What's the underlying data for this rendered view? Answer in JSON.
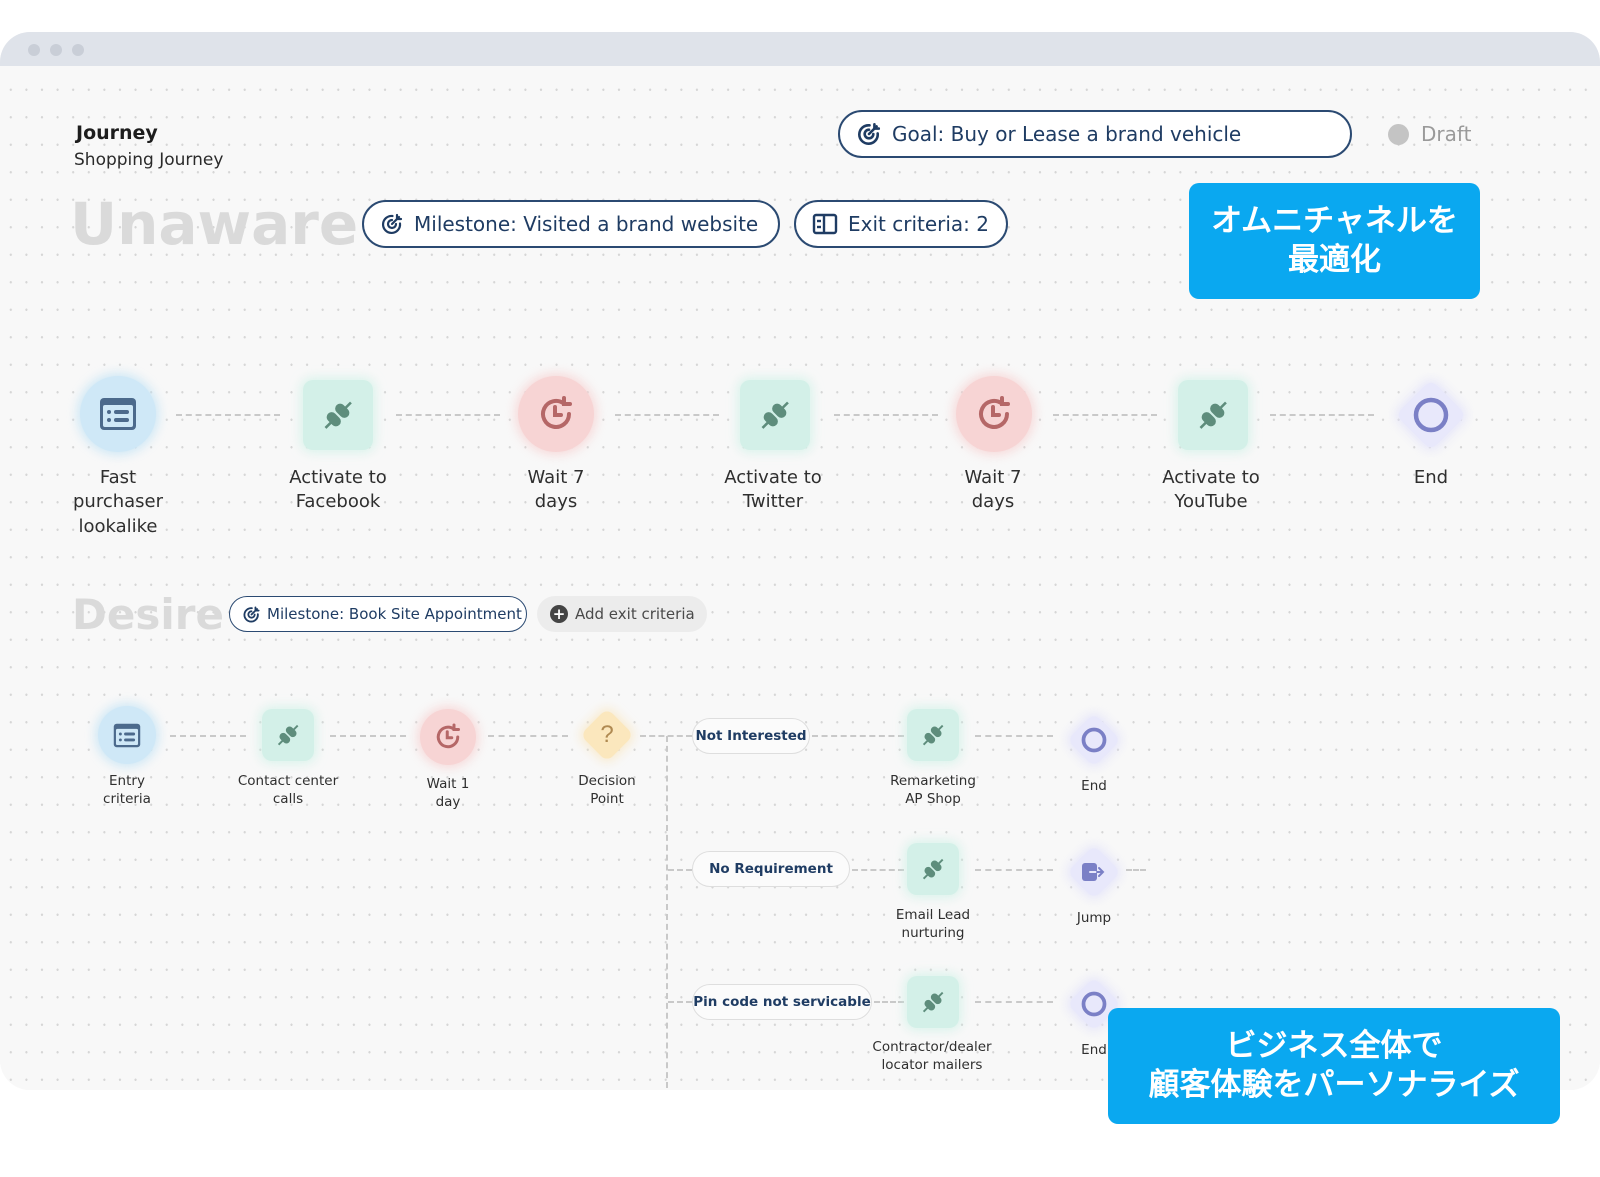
{
  "window": {
    "controls": [
      "close",
      "minimize",
      "maximize"
    ]
  },
  "header": {
    "label": "Journey",
    "journey_name": "Shopping Journey",
    "goal": "Goal: Buy or Lease a brand vehicle",
    "status": "Draft"
  },
  "stages": {
    "unaware": {
      "title": "Unaware",
      "milestone": "Milestone: Visited a brand website",
      "exit_criteria": "Exit criteria: 2",
      "nodes": [
        {
          "type": "audience",
          "icon": "list-icon",
          "label": "Fast\npurchaser\nlookalike"
        },
        {
          "type": "activate",
          "icon": "plug-icon",
          "label": "Activate to\nFacebook"
        },
        {
          "type": "wait",
          "icon": "clock-icon",
          "label": "Wait 7\ndays"
        },
        {
          "type": "activate",
          "icon": "plug-icon",
          "label": "Activate to\nTwitter"
        },
        {
          "type": "wait",
          "icon": "clock-icon",
          "label": "Wait 7\ndays"
        },
        {
          "type": "activate",
          "icon": "plug-icon",
          "label": "Activate to\nYouTube"
        },
        {
          "type": "end",
          "icon": "circle-icon",
          "label": "End"
        }
      ]
    },
    "desire": {
      "title": "Desire",
      "milestone": "Milestone: Book Site Appointment",
      "add_exit": "Add exit criteria",
      "nodes": [
        {
          "type": "audience",
          "icon": "list-icon",
          "label": "Entry\ncriteria"
        },
        {
          "type": "activate",
          "icon": "plug-icon",
          "label": "Contact center\ncalls"
        },
        {
          "type": "wait",
          "icon": "clock-icon",
          "label": "Wait 1\nday"
        },
        {
          "type": "decision",
          "icon": "question-icon",
          "label": "Decision\nPoint",
          "glyph": "?"
        }
      ],
      "branches": [
        {
          "condition": "Not Interested",
          "action": "Remarketing\nAP Shop",
          "terminal": "End",
          "terminal_type": "end"
        },
        {
          "condition": "No Requirement",
          "action": "Email Lead\nnurturing",
          "terminal": "Jump",
          "terminal_type": "jump"
        },
        {
          "condition": "Pin code not servicable",
          "action": "Contractor/dealer\nlocator mailers",
          "terminal": "End",
          "terminal_type": "end"
        }
      ]
    }
  },
  "callouts": {
    "top": "オムニチャネルを\n最適化",
    "bottom": "ビジネス全体で\n顧客体験をパーソナライズ"
  },
  "colors": {
    "accent_navy": "#1f3c63",
    "callout_blue": "#0aa8f0",
    "audience_bg": "#cfe8f7",
    "activate_bg": "#d3f0e8",
    "wait_bg": "#f7d4d4",
    "end_bg": "#e8e8fb",
    "decision_bg": "#fbe7bd"
  }
}
